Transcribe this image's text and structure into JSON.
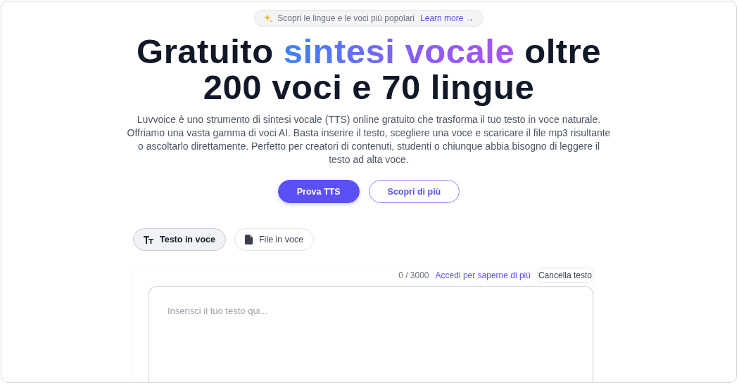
{
  "announcement": {
    "text": "Scopri le lingue e le voci più popolari",
    "link": "Learn more →"
  },
  "headline": [
    {
      "text": "Gratuito ",
      "kind": "plain"
    },
    {
      "text": "sintesi vocale",
      "kind": "gradient"
    },
    {
      "text": " oltre 200 voci e 70 lingue",
      "kind": "plain"
    }
  ],
  "description": "Luvvoice è uno strumento di sintesi vocale (TTS) online gratuito che trasforma il tuo testo in voce naturale. Offriamo una vasta gamma di voci AI. Basta inserire il testo, scegliere una voce e scaricare il file mp3 risultante o ascoltarlo direttamente. Perfetto per creatori di contenuti, studenti o chiunque abbia bisogno di leggere il testo ad alta voce.",
  "buttons": [
    {
      "label": "Prova TTS",
      "kind": "primary"
    },
    {
      "label": "Scopri di più",
      "kind": "outline"
    }
  ],
  "tabs": [
    {
      "label": "Testo in voce",
      "kind": "text",
      "selected": true
    },
    {
      "label": "File in voce",
      "kind": "file",
      "selected": false
    }
  ],
  "editor": {
    "counter": "0 / 3000",
    "login_link": "Accedi per saperne di più",
    "clear_button": "Cancella testo",
    "placeholder": "Inserisci il tuo testo qui..."
  }
}
